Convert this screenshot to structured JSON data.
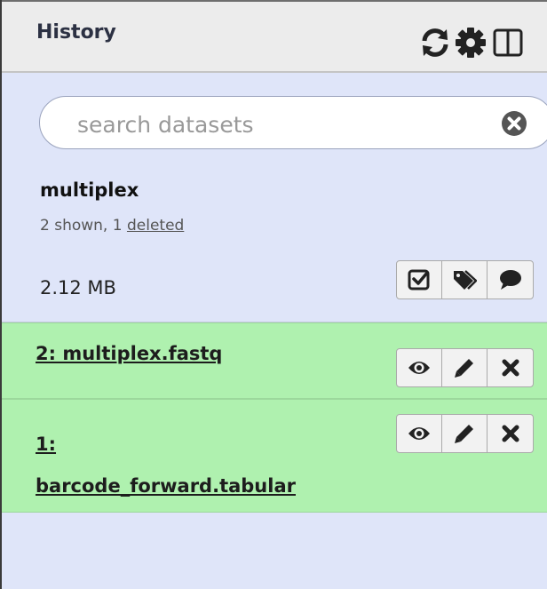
{
  "header": {
    "title": "History",
    "icons": [
      "refresh-icon",
      "gear-icon",
      "columns-icon"
    ]
  },
  "search": {
    "placeholder": "search datasets",
    "value": ""
  },
  "history": {
    "name": "multiplex",
    "shown_text": "2 shown, 1 ",
    "deleted_link": "deleted",
    "size": "2.12 MB",
    "action_icons": [
      "checkbox-icon",
      "tags-icon",
      "comment-icon"
    ]
  },
  "datasets": [
    {
      "title": "2: multiplex.fastq",
      "state_color": "#aff1af",
      "action_icons": [
        "eye-icon",
        "pencil-icon",
        "delete-icon"
      ]
    },
    {
      "title_line1": "1:",
      "title_line2": "barcode_forward.tabular",
      "state_color": "#aff1af",
      "action_icons": [
        "eye-icon",
        "pencil-icon",
        "delete-icon"
      ]
    }
  ],
  "colors": {
    "panel_bg": "#dfe5f9",
    "header_bg": "#ececec",
    "dataset_ok": "#aff1af"
  }
}
